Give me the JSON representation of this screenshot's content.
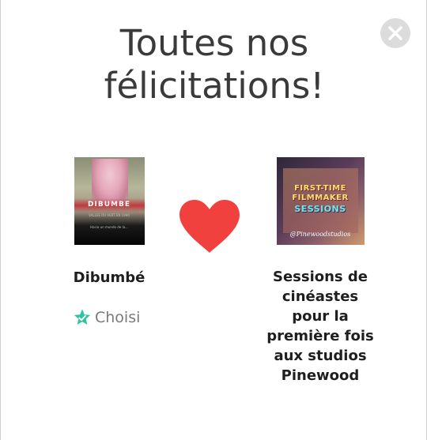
{
  "modal": {
    "title_line1": "Toutes nos",
    "title_line2": "félicitations!",
    "close_icon": "close-icon"
  },
  "films": [
    {
      "name": "Dibumbé",
      "poster": {
        "title_text": "DIBUMBE",
        "small_text": "VALLEE DU VERT EN 1990",
        "footer_text": "Hacia un mundo de la..."
      }
    },
    {
      "name": "Sessions de cinéastes pour la première fois aux studios Pinewood",
      "poster": {
        "line1": "FIRST-TIME",
        "line2": "FILMMAKER",
        "line3": "SESSIONS",
        "handle": "@Pinewoodstudios"
      }
    }
  ],
  "status": {
    "chosen_label": "Choisi",
    "chosen_icon": "star-check-icon",
    "accent_color": "#2ec4a0"
  },
  "match": {
    "heart_icon": "heart-icon",
    "heart_color": "#f0413f"
  }
}
